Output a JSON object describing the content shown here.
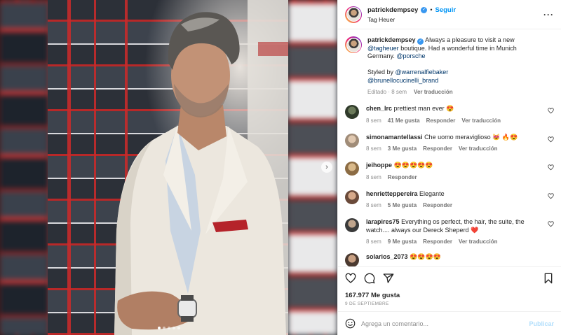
{
  "post": {
    "username": "patrickdempsey",
    "follow_label": "Seguir",
    "dot": "•",
    "location": "Tag Heuer"
  },
  "caption": {
    "username": "patrickdempsey",
    "text_1": "Always a pleasure to visit a new",
    "mention_1": "@tagheuer",
    "text_2": "boutique. Had a wonderful time in Munich Germany.",
    "mention_2": "@porsche",
    "styled_by": "Styled by",
    "mention_3": "@warrenalfiebaker",
    "mention_4": "@brunellocucinelli_brand",
    "edited": "Editado",
    "time": "8 sem",
    "translate": "Ver traducción"
  },
  "comments": [
    {
      "user": "chen_lrc",
      "text": "prettiest man ever 😍",
      "time": "8 sem",
      "likes": "41 Me gusta",
      "reply": "Responder",
      "translate": "Ver traducción"
    },
    {
      "user": "simonamantellassi",
      "text": "Che uomo meraviglioso 😻 🔥😍",
      "time": "8 sem",
      "likes": "3 Me gusta",
      "reply": "Responder",
      "translate": "Ver traducción"
    },
    {
      "user": "jeihoppe",
      "text": "😍😍😍😍😍",
      "time": "8 sem",
      "likes": "",
      "reply": "Responder",
      "translate": ""
    },
    {
      "user": "henrietteppereira",
      "text": "Elegante",
      "time": "8 sem",
      "likes": "5 Me gusta",
      "reply": "Responder",
      "translate": ""
    },
    {
      "user": "larapires75",
      "text": "Everything os perfect, the hair, the suite, the watch.... always our Dereck Sheperd ❤️",
      "time": "8 sem",
      "likes": "9 Me gusta",
      "reply": "Responder",
      "translate": "Ver traducción"
    },
    {
      "user": "solarios_2073",
      "text": "😍😍😍😍",
      "time": "",
      "likes": "",
      "reply": "",
      "translate": ""
    }
  ],
  "stats": {
    "likes": "167.977 Me gusta",
    "date": "9 DE SEPTIEMBRE"
  },
  "comment_box": {
    "placeholder": "Agrega un comentario...",
    "post_label": "Publicar"
  },
  "icons": [
    "verified-icon",
    "more-icon",
    "heart-icon",
    "comment-icon",
    "share-icon",
    "bookmark-icon",
    "emoji-icon",
    "chevron-right-icon"
  ],
  "colors": {
    "accent": "#0095f6",
    "link": "#00376b",
    "muted": "#8e8e8e",
    "heart": "#ed4956"
  },
  "carousel": {
    "slides": 5,
    "active": 1
  }
}
